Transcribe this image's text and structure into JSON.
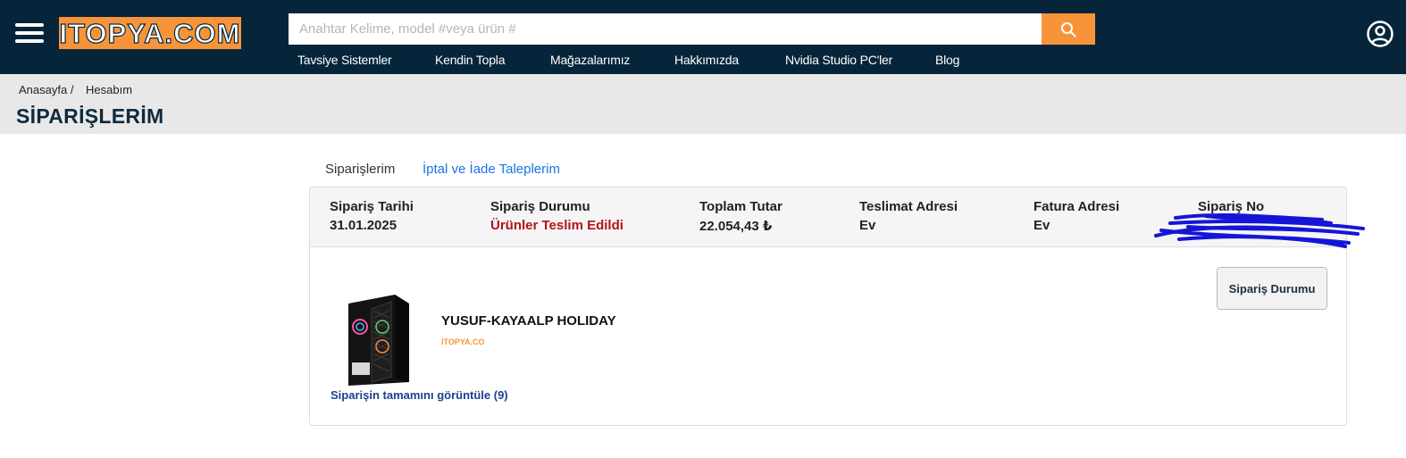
{
  "header": {
    "logo_text": "ITOPYA.COM",
    "search": {
      "placeholder": "Anahtar Kelime, model #veya ürün #",
      "value": ""
    },
    "search_icon": "search-icon",
    "account_icon": "user-circle-icon",
    "menu_icon": "hamburger-menu-icon",
    "nav": [
      "Tavsiye Sistemler",
      "Kendin Topla",
      "Mağazalarımız",
      "Hakkımızda",
      "Nvidia Studio PC'ler",
      "Blog"
    ]
  },
  "breadcrumb": [
    "Anasayfa /",
    "Hesabım"
  ],
  "page_title": "SİPARİŞLERİM",
  "tabs": [
    {
      "label": "Siparişlerim",
      "active": true
    },
    {
      "label": "İptal ve İade Taleplerim",
      "active": false
    }
  ],
  "order": {
    "columns": [
      {
        "label": "Sipariş Tarihi",
        "value": "31.01.2025"
      },
      {
        "label": "Sipariş Durumu",
        "value": "Ürünler Teslim Edildi"
      },
      {
        "label": "Toplam Tutar",
        "value": "22.054,43 ₺"
      },
      {
        "label": "Teslimat Adresi",
        "value": "Ev"
      },
      {
        "label": "Fatura Adresi",
        "value": "Ev"
      },
      {
        "label": "Sipariş No",
        "value": ""
      }
    ],
    "product_name": "YUSUF-KAYAALP HOLIDAY",
    "brand_logo_text": "ITOPYA.COM",
    "view_all_label": "Siparişin tamamını görüntüle (9)",
    "status_button_label": "Sipariş Durumu"
  },
  "colors": {
    "header_bg": "#06253a",
    "accent_orange": "#f7943a",
    "status_red": "#b3121c",
    "link_blue": "#1a73e8",
    "band_gray": "#e8e8e8"
  }
}
